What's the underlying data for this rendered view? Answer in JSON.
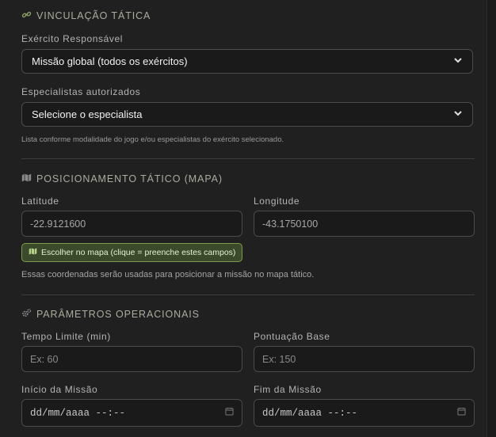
{
  "vinculacao": {
    "title": "VINCULAÇÃO TÁTICA",
    "army_label": "Exército Responsável",
    "army_value": "Missão global (todos os exércitos)",
    "specialists_label": "Especialistas autorizados",
    "specialists_value": "Selecione o especialista",
    "specialists_help": "Lista conforme modalidade do jogo e/ou especialistas do exército selecionado."
  },
  "posicionamento": {
    "title": "POSICIONAMENTO TÁTICO (MAPA)",
    "latitude_label": "Latitude",
    "latitude_value": "-22.9121600",
    "longitude_label": "Longitude",
    "longitude_value": "-43.1750100",
    "map_button_label": "Escolher no mapa (clique = preenche estes campos)",
    "help": "Essas coordenadas serão usadas para posicionar a missão no mapa tático."
  },
  "parametros": {
    "title": "PARÂMETROS OPERACIONAIS",
    "time_limit_label": "Tempo Limite (min)",
    "time_limit_placeholder": "Ex: 60",
    "base_score_label": "Pontuação Base",
    "base_score_placeholder": "Ex: 150",
    "start_label": "Início da Missão",
    "start_value": "dd/mm/aaaa --:--",
    "end_label": "Fim da Missão",
    "end_value": "dd/mm/aaaa --:--"
  },
  "icons": {
    "link": "link-icon",
    "map": "map-icon",
    "gears": "gears-icon",
    "chevron": "chevron-down-icon",
    "calendar": "calendar-icon"
  },
  "colors": {
    "accent_green": "#7e9a4e",
    "button_bg": "#3a4a2a"
  }
}
